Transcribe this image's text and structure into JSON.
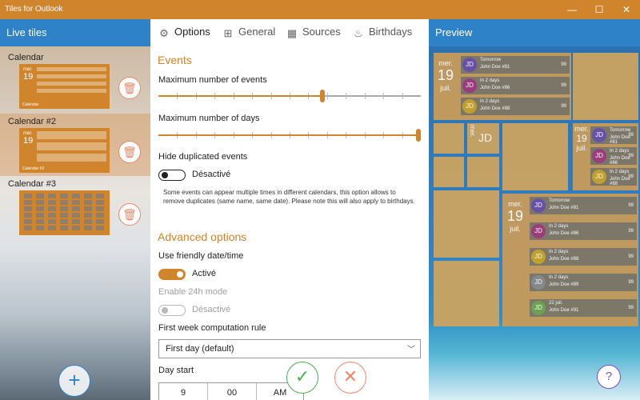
{
  "window": {
    "title": "Tiles for Outlook",
    "minimize": "—",
    "maximize": "☐",
    "close": "✕"
  },
  "left": {
    "header": "Live tiles",
    "calendars": [
      {
        "label": "Calendar"
      },
      {
        "label": "Calendar #2"
      },
      {
        "label": "Calendar #3"
      }
    ],
    "add_label": "+"
  },
  "tabs": [
    {
      "label": "Options",
      "icon": "gear-icon"
    },
    {
      "label": "General",
      "icon": "grid-icon"
    },
    {
      "label": "Sources",
      "icon": "calendar-icon"
    },
    {
      "label": "Birthdays",
      "icon": "cake-icon"
    }
  ],
  "events": {
    "title": "Events",
    "max_events_label": "Maximum number of events",
    "max_events_value": 0.63,
    "max_days_label": "Maximum number of days",
    "max_days_value": 1.0,
    "hide_dup_label": "Hide duplicated events",
    "hide_dup_state": "Désactivé",
    "note": "Some events can appear multiple times in different calendars, this option allows to remove duplicates (same name, same date). Please note this will also apply to birthdays."
  },
  "advanced": {
    "title": "Advanced options",
    "friendly_label": "Use friendly date/time",
    "friendly_state": "Activé",
    "h24_label": "Enable 24h mode",
    "h24_state": "Désactivé",
    "week_rule_label": "First week computation rule",
    "week_rule_value": "First day (default)",
    "day_start_label": "Day start",
    "day_start": {
      "hour": "9",
      "minute": "00",
      "ampm": "AM"
    }
  },
  "actions": {
    "ok": "✓",
    "cancel": "✕"
  },
  "preview": {
    "header": "Preview",
    "date": {
      "day": "mer.",
      "num": "19",
      "month": "juil."
    },
    "rows_top": [
      {
        "initials": "JD",
        "time": "Tomorrow",
        "name": "John Doe #81",
        "count": "99",
        "color": "#6b4fa3"
      },
      {
        "initials": "JD",
        "time": "In 2 days",
        "name": "John Doe #86",
        "count": "99",
        "color": "#a03a78"
      },
      {
        "initials": "JD",
        "time": "In 2 days",
        "name": "John Doe #88",
        "count": "99",
        "color": "#c9a227"
      }
    ],
    "rows_small": [
      {
        "initials": "JD",
        "time": "Tomorrow",
        "name": "John Doe #81",
        "count": "99",
        "color": "#6b4fa3"
      },
      {
        "initials": "JD",
        "time": "In 2 days",
        "name": "John Doe #86",
        "count": "99",
        "color": "#a03a78"
      },
      {
        "initials": "JD",
        "time": "In 2 days",
        "name": "John Doe #88",
        "count": "99",
        "color": "#c9a227"
      }
    ],
    "rows_big": [
      {
        "initials": "JD",
        "time": "Tomorrow",
        "name": "John Doe #81",
        "count": "99",
        "color": "#6b4fa3"
      },
      {
        "initials": "JD",
        "time": "In 2 days",
        "name": "John Doe #86",
        "count": "99",
        "color": "#a03a78"
      },
      {
        "initials": "JD",
        "time": "In 2 days",
        "name": "John Doe #88",
        "count": "99",
        "color": "#c9a227"
      },
      {
        "initials": "JD",
        "time": "In 2 days",
        "name": "John Doe #89",
        "count": "99",
        "color": "#8a8a8a"
      },
      {
        "initials": "JD",
        "time": "22 juil.",
        "name": "John Doe #91",
        "count": "99",
        "color": "#6fa34a"
      }
    ],
    "mini_initials": "JD",
    "help": "?"
  },
  "colors": {
    "accent": "#d0842b",
    "blue": "#2d82c8",
    "delete": "#e8896a",
    "ok": "#4caf50",
    "help": "#7a4cc0"
  }
}
